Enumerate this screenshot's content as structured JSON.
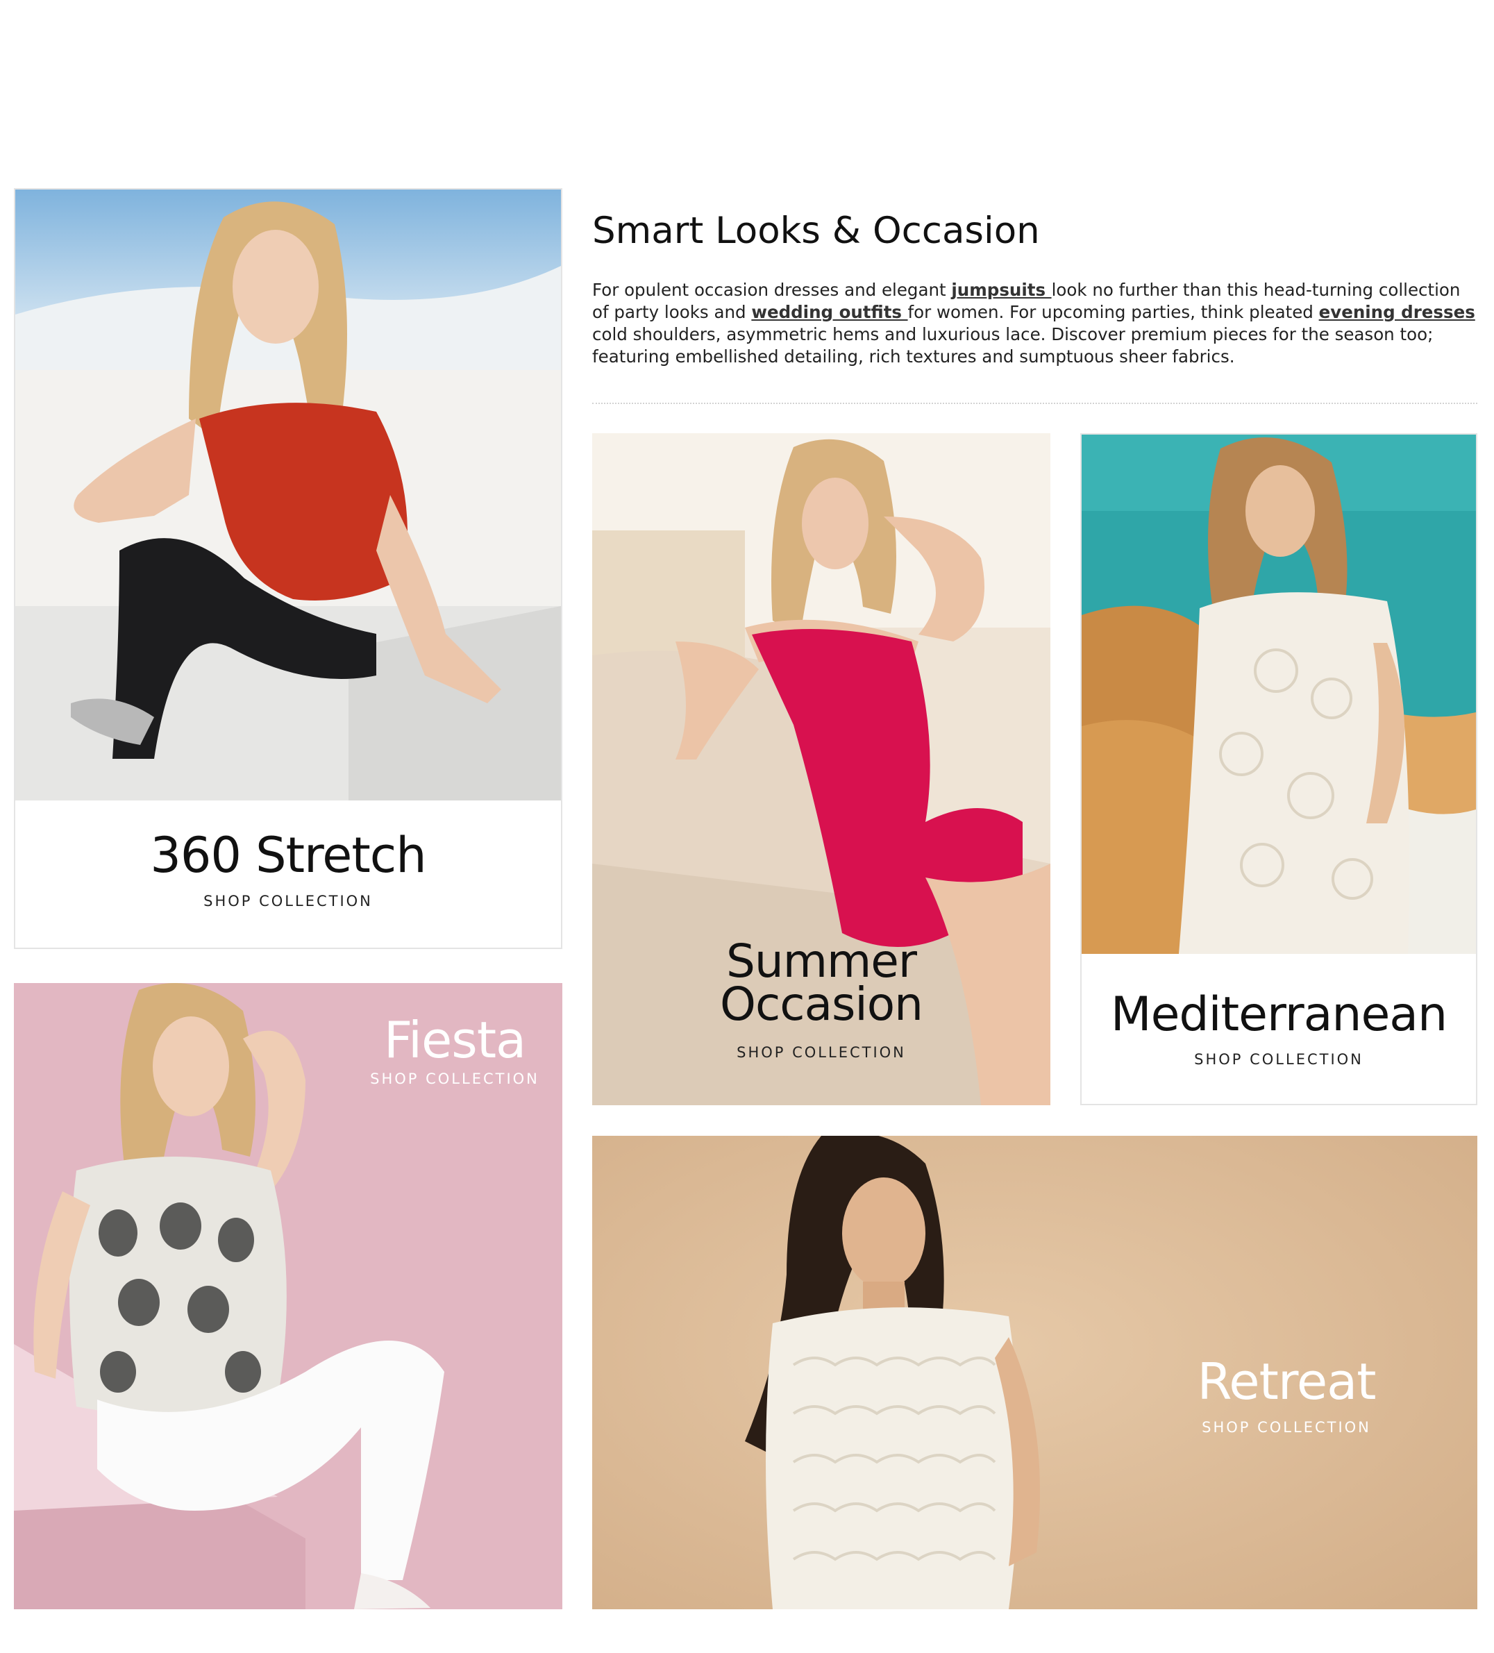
{
  "intro": {
    "title": "Smart Looks & Occasion",
    "text_parts": {
      "p1": "For opulent occasion dresses and elegant ",
      "link1": "jumpsuits ",
      "p2": "look no further than this head-turning collection of party looks and ",
      "link2": "wedding outfits ",
      "p3": "for women. For upcoming parties, think pleated ",
      "link3": "evening dresses",
      "p4": " cold shoulders, asymmetric hems and luxurious lace. Discover premium pieces for the season too; featuring embellished detailing, rich textures and sumptuous sheer fabrics."
    }
  },
  "cards": {
    "stretch": {
      "title": "360 Stretch",
      "link": "SHOP COLLECTION"
    },
    "summer": {
      "title_line1": "Summer",
      "title_line2": "Occasion",
      "link": "SHOP COLLECTION"
    },
    "mediterranean": {
      "title": "Mediterranean",
      "link": "SHOP COLLECTION"
    },
    "fiesta": {
      "title": "Fiesta",
      "link": "SHOP COLLECTION"
    },
    "retreat": {
      "title": "Retreat",
      "link": "SHOP COLLECTION"
    }
  },
  "colors": {
    "fiesta_bg": "#e2b7c2",
    "retreat_bg": "#d9b796",
    "summer_dress": "#d8114f",
    "stretch_top": "#c7341f"
  }
}
